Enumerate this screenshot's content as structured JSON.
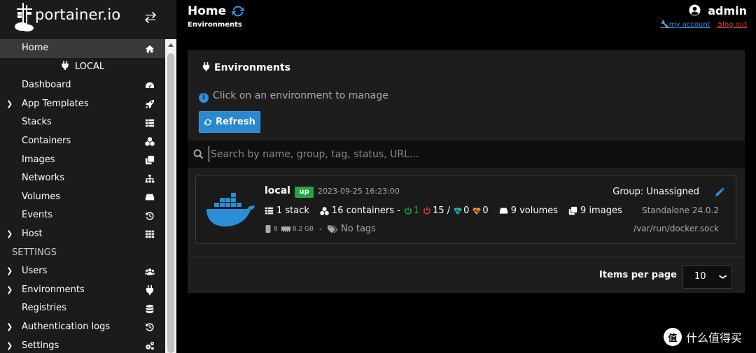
{
  "app": {
    "logo_text": "portainer.io"
  },
  "sidebar": {
    "items": [
      {
        "label": "Home",
        "icon": "home-icon",
        "active": true
      },
      {
        "label": "LOCAL",
        "icon": "plug-icon"
      },
      {
        "label": "Dashboard",
        "icon": "tachometer-icon"
      },
      {
        "label": "App Templates",
        "icon": "rocket-icon",
        "expandable": true
      },
      {
        "label": "Stacks",
        "icon": "th-list-icon"
      },
      {
        "label": "Containers",
        "icon": "cubes-icon"
      },
      {
        "label": "Images",
        "icon": "clone-icon"
      },
      {
        "label": "Networks",
        "icon": "sitemap-icon"
      },
      {
        "label": "Volumes",
        "icon": "hdd-icon"
      },
      {
        "label": "Events",
        "icon": "history-icon"
      },
      {
        "label": "Host",
        "icon": "th-icon",
        "expandable": true
      },
      {
        "label": "SETTINGS"
      },
      {
        "label": "Users",
        "icon": "users-icon",
        "expandable": true
      },
      {
        "label": "Environments",
        "icon": "plug-icon",
        "expandable": true
      },
      {
        "label": "Registries",
        "icon": "database-icon"
      },
      {
        "label": "Authentication logs",
        "icon": "history-icon",
        "expandable": true
      },
      {
        "label": "Settings",
        "icon": "cogs-icon",
        "expandable": true
      }
    ]
  },
  "header": {
    "title": "Home",
    "breadcrumb": "Environments",
    "username": "admin",
    "my_account": "my account",
    "log_out": "log out"
  },
  "panel": {
    "title": "Environments",
    "info": "Click on an environment to manage",
    "refresh_label": "Refresh",
    "search_placeholder": "Search by name, group, tag, status, URL..."
  },
  "environment": {
    "name": "local",
    "status": "up",
    "last_check": "2023-09-25 16:23:00",
    "stacks": "1 stack",
    "containers": "16 containers -",
    "running": "1",
    "stopped": "15 /",
    "healthy": "0",
    "unhealthy": "0",
    "volumes": "9 volumes",
    "images": "9 images",
    "cpu": "8",
    "memory": "8.2 GB",
    "separator": "-",
    "tags": "No tags",
    "group": "Group: Unassigned",
    "engine": "Standalone 24.0.2",
    "socket": "/var/run/docker.sock"
  },
  "pagination": {
    "items_per_page_label": "Items per page",
    "items_per_page_value": "10"
  },
  "watermark": {
    "logo_char": "值",
    "text": "什么值得买"
  },
  "colors": {
    "accent_blue": "#2988cf",
    "status_green": "#23a53f",
    "logout_red": "#e23c3c",
    "docker_blue": "#2a8fd6"
  }
}
